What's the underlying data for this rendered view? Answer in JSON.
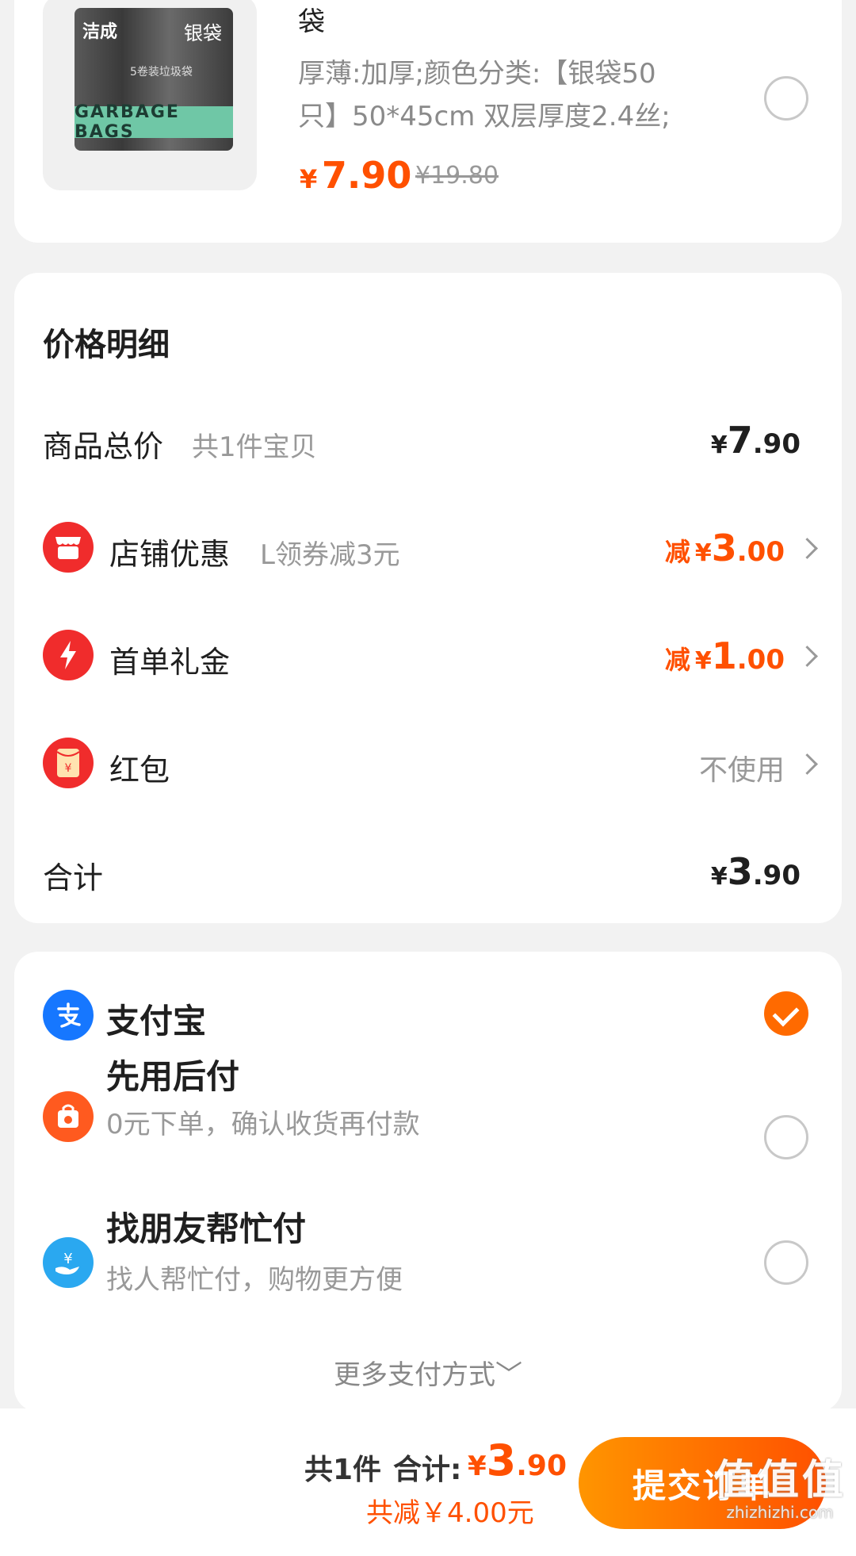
{
  "product": {
    "title_tail": "袋",
    "image": {
      "brand": "洁成",
      "bag_name": "银袋",
      "band_text": "GARBAGE BAGS",
      "pack_note": "5卷装垃圾袋"
    },
    "spec_line1": "厚薄:加厚;颜色分类:【银袋50",
    "spec_line2": "只】50*45cm 双层厚度2.4丝;",
    "price_yen": "¥",
    "price": "7.90",
    "original_price": "¥19.80"
  },
  "price_detail": {
    "title": "价格明细",
    "rows": [
      {
        "label": "商品总价",
        "sub": "共1件宝贝",
        "yen": "¥",
        "int": "7",
        "dec": ".90"
      },
      {
        "label": "店铺优惠",
        "sub": "L领券减3元",
        "prefix": "减",
        "yen": "¥",
        "int": "3",
        "dec": ".00"
      },
      {
        "label": "首单礼金",
        "prefix": "减",
        "yen": "¥",
        "int": "1",
        "dec": ".00"
      },
      {
        "label": "红包",
        "value": "不使用"
      },
      {
        "label": "合计",
        "yen": "¥",
        "int": "3",
        "dec": ".90"
      }
    ]
  },
  "payment": {
    "methods": [
      {
        "name": "支付宝",
        "selected": true
      },
      {
        "name": "先用后付",
        "desc": "0元下单，确认收货再付款",
        "selected": false
      },
      {
        "name": "找朋友帮忙付",
        "desc": "找人帮忙付，购物更方便",
        "selected": false
      }
    ],
    "more": "更多支付方式﹀"
  },
  "bottom_bar": {
    "count": "共1件",
    "total_label": "合计:",
    "yen": "¥",
    "int": "3",
    "dec": ".90",
    "saved": "共减￥4.00元",
    "submit": "提交订单"
  },
  "watermark": {
    "mark": "值值值",
    "url": "zhizhizhi.com"
  },
  "colors": {
    "accent": "#ff5000",
    "alipay": "#1677ff",
    "icon_red": "#f02c2c"
  },
  "icons": [
    "shop-coupon-icon",
    "lightning-icon",
    "red-packet-icon",
    "alipay-icon",
    "pay-later-icon",
    "friend-pay-icon",
    "check-icon",
    "chevron-right-icon"
  ]
}
